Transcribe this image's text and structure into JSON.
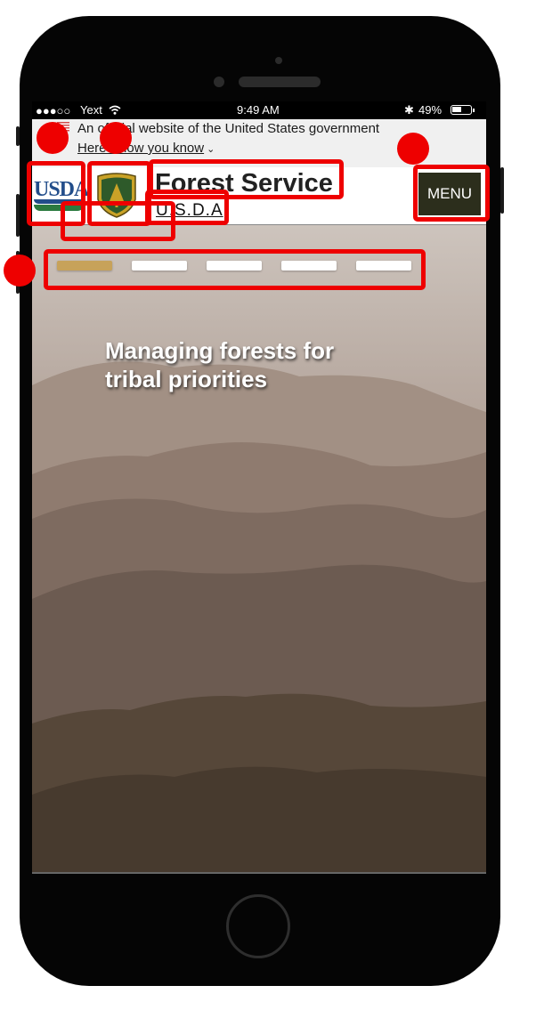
{
  "status_bar": {
    "signal": "●●●○○",
    "carrier": "Yext",
    "wifi_icon": "wifi-icon",
    "time": "9:49 AM",
    "bluetooth": "✱",
    "battery": "49%"
  },
  "gov_banner": {
    "text": "An official website of the United States government",
    "link": "Here's how you know",
    "chevron": "⌄"
  },
  "header": {
    "usda_logo_text": "USDA",
    "shield_text": "USFS",
    "title": "Forest Service",
    "subtitle": "U.S.D.A",
    "menu_label": "MENU"
  },
  "carousel": {
    "indicator_count": 5,
    "active_index": 0
  },
  "hero": {
    "headline": "Managing forests for tribal priorities"
  },
  "colors": {
    "menu_bg": "#2c2e1c",
    "active_dot": "#c7a25a",
    "annotation": "#ee0000"
  }
}
